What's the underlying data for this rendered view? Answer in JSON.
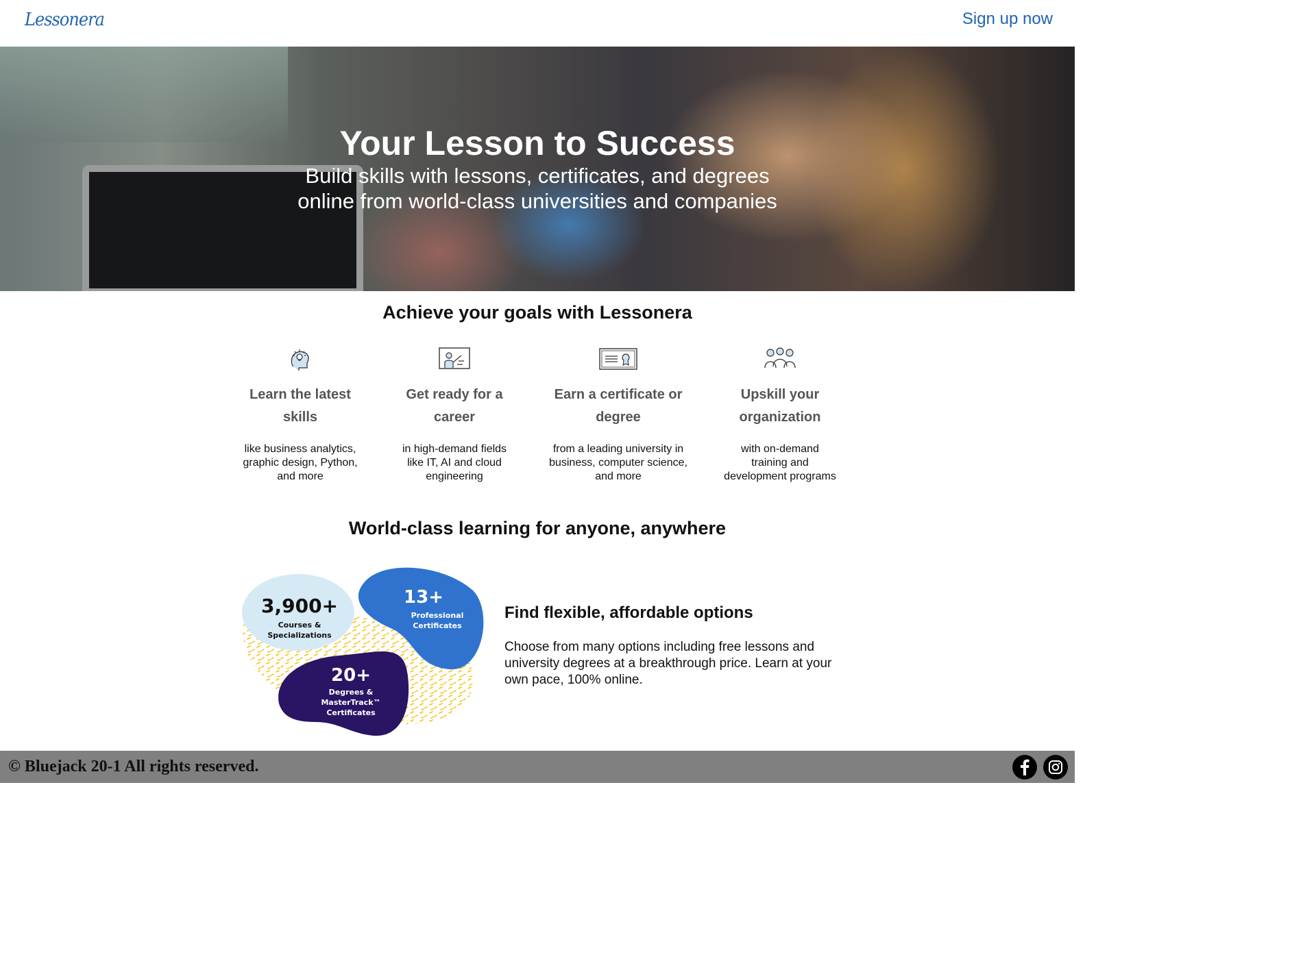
{
  "header": {
    "logo": "Lessonera",
    "signup_label": "Sign up now"
  },
  "hero": {
    "title": "Your Lesson to Success",
    "subtitle_line1": "Build skills with lessons, certificates, and degrees",
    "subtitle_line2": "online from world-class universities and companies"
  },
  "goals": {
    "title": "Achieve your goals with Lessonera",
    "items": [
      {
        "icon": "head-lightbulb-icon",
        "heading_line1": "Learn the latest",
        "heading_line2": "skills",
        "desc_line1": "like business analytics,",
        "desc_line2": "graphic design, Python,",
        "desc_line3": "and more"
      },
      {
        "icon": "presenter-board-icon",
        "heading_line1": "Get ready for a",
        "heading_line2": "career",
        "desc_line1": "in high-demand fields",
        "desc_line2": "like IT, AI and cloud",
        "desc_line3": "engineering"
      },
      {
        "icon": "certificate-icon",
        "heading_line1": "Earn a certificate or",
        "heading_line2": "degree",
        "desc_line1": "from a leading university in",
        "desc_line2": "business, computer science,",
        "desc_line3": "and more"
      },
      {
        "icon": "people-group-icon",
        "heading_line1": "Upskill your",
        "heading_line2": "organization",
        "desc_line1": "with on-demand",
        "desc_line2": "training and",
        "desc_line3": "development programs"
      }
    ]
  },
  "world": {
    "title": "World-class learning for anyone, anywhere",
    "stats": [
      {
        "value": "3,900+",
        "label_line1": "Courses &",
        "label_line2": "Specializations"
      },
      {
        "value": "13+",
        "label_line1": "Professional",
        "label_line2": "Certificates"
      },
      {
        "value": "20+",
        "label_line1": "Degrees &",
        "label_line2": "MasterTrack™",
        "label_line3": "Certificates"
      }
    ],
    "find_title": "Find flexible, affordable options",
    "find_text": "Choose from many options including free lessons and university degrees at a breakthrough price. Learn at your own pace, 100% online."
  },
  "footer": {
    "copyright": "© Bluejack 20-1 All rights reserved.",
    "social": [
      "facebook-icon",
      "instagram-icon"
    ]
  },
  "colors": {
    "brand": "#1f63b4",
    "footer_bg": "#808080",
    "blob_light": "#d6eaf5",
    "blob_blue": "#2f73cf",
    "blob_navy": "#2a1464",
    "dots": "#f2c316"
  }
}
